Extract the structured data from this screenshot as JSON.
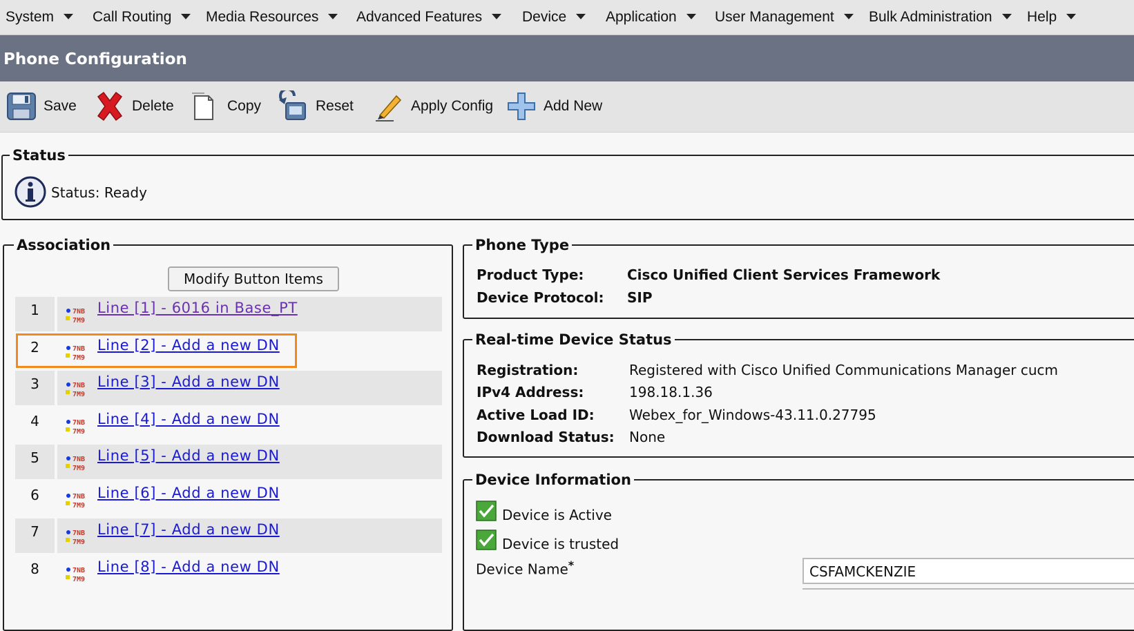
{
  "menu": {
    "items": [
      "System",
      "Call Routing",
      "Media Resources",
      "Advanced Features",
      "Device",
      "Application",
      "User Management",
      "Bulk Administration",
      "Help"
    ]
  },
  "page": {
    "title": "Phone Configuration"
  },
  "toolbar": {
    "save": "Save",
    "delete": "Delete",
    "copy": "Copy",
    "reset": "Reset",
    "apply_config": "Apply Config",
    "add_new": "Add New"
  },
  "status": {
    "legend": "Status",
    "text": "Status: Ready",
    "icon": "info-icon"
  },
  "association": {
    "legend": "Association",
    "modify_button": "Modify Button Items",
    "lines": [
      {
        "num": "1",
        "label": "Line [1] - 6016 in Base_PT"
      },
      {
        "num": "2",
        "label": "Line [2] - Add a new DN"
      },
      {
        "num": "3",
        "label": "Line [3] - Add a new DN"
      },
      {
        "num": "4",
        "label": "Line [4] - Add a new DN"
      },
      {
        "num": "5",
        "label": "Line [5] - Add a new DN"
      },
      {
        "num": "6",
        "label": "Line [6] - Add a new DN"
      },
      {
        "num": "7",
        "label": "Line [7] - Add a new DN"
      },
      {
        "num": "8",
        "label": "Line [8] - Add a new DN"
      }
    ],
    "highlight_color": "#f08a1c"
  },
  "phone_type": {
    "legend": "Phone Type",
    "product_type_label": "Product Type:",
    "product_type_value": "Cisco Unified Client Services Framework",
    "protocol_label": "Device Protocol:",
    "protocol_value": "SIP"
  },
  "realtime": {
    "legend": "Real-time Device Status",
    "registration_label": "Registration:",
    "registration_value": "Registered with Cisco Unified Communications Manager cucm",
    "ipv4_label": "IPv4 Address:",
    "ipv4_value": "198.18.1.36",
    "load_label": "Active Load ID:",
    "load_value": "Webex_for_Windows-43.11.0.27795",
    "download_label": "Download Status:",
    "download_value": "None"
  },
  "device_info": {
    "legend": "Device Information",
    "active_label": "Device is Active",
    "trusted_label": "Device is trusted",
    "name_label": "Device Name",
    "required_mark": "*",
    "name_value": "CSFAMCKENZIE"
  },
  "colors": {
    "title_bar": "#6b7283",
    "link": "#1a1ad6",
    "visited_link": "#6b30b0"
  }
}
